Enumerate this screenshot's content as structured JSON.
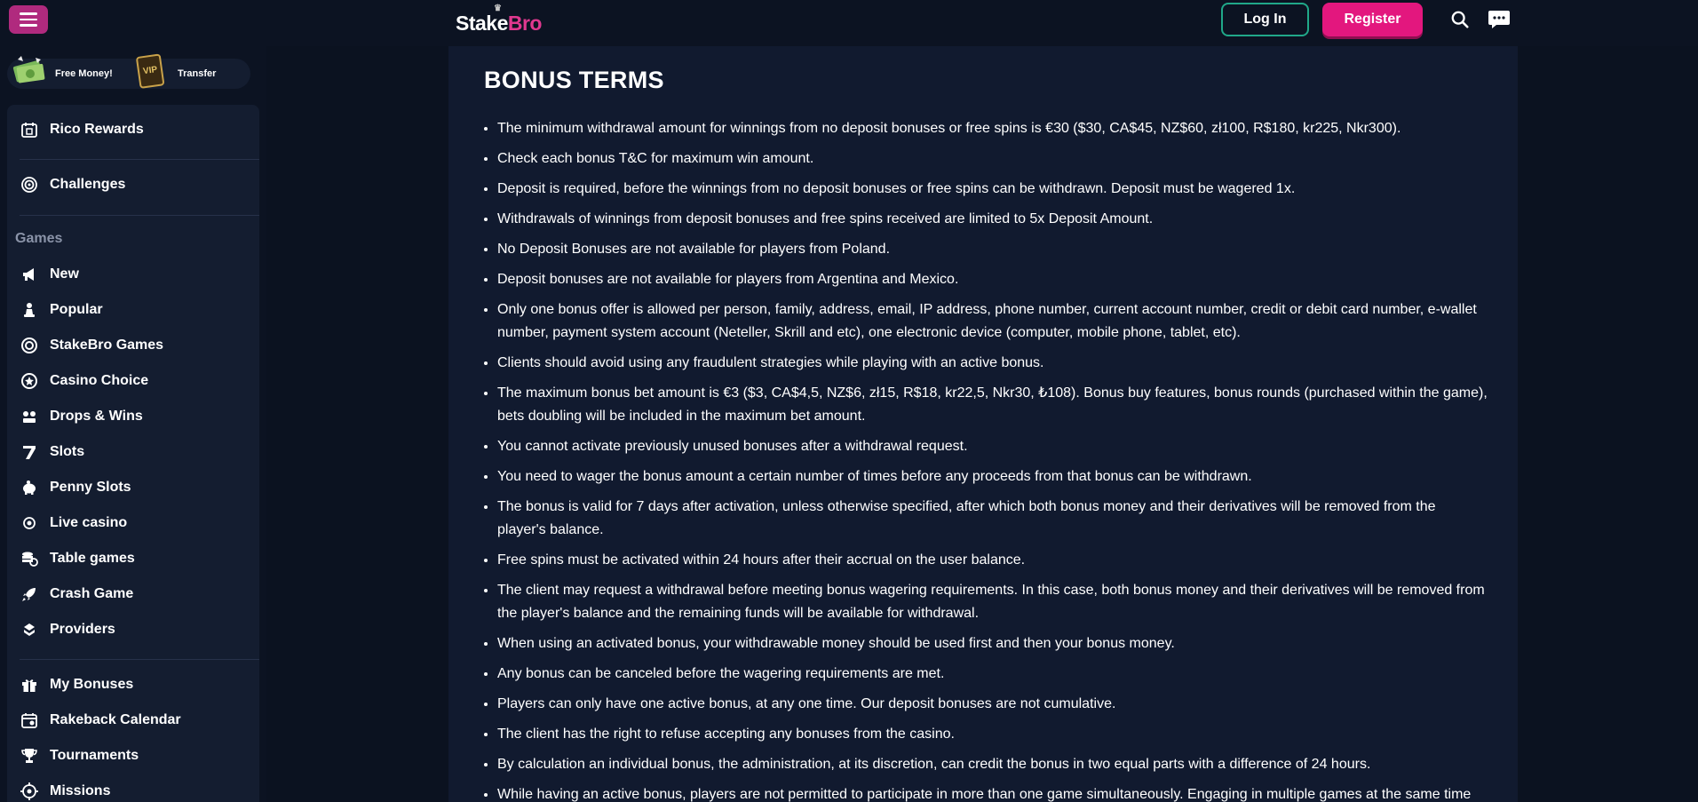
{
  "header": {
    "logo_part1": "Stake",
    "logo_part2": "Bro",
    "login_label": "Log In",
    "register_label": "Register"
  },
  "sidebar": {
    "promos": [
      {
        "label": "Free Money!"
      },
      {
        "label": "Transfer"
      }
    ],
    "top_items": [
      {
        "label": "Rico Rewards",
        "icon": "calendar-gift-icon"
      },
      {
        "label": "Challenges",
        "icon": "target-icon"
      }
    ],
    "games_label": "Games",
    "game_items": [
      {
        "label": "New",
        "icon": "megaphone-icon"
      },
      {
        "label": "Popular",
        "icon": "chess-pawn-icon"
      },
      {
        "label": "StakeBro Games",
        "icon": "chip-icon"
      },
      {
        "label": "Casino Choice",
        "icon": "star-badge-icon"
      },
      {
        "label": "Drops & Wins",
        "icon": "drops-wins-icon"
      },
      {
        "label": "Slots",
        "icon": "seven-icon"
      },
      {
        "label": "Penny Slots",
        "icon": "piggy-bank-icon"
      },
      {
        "label": "Live casino",
        "icon": "live-icon"
      },
      {
        "label": "Table games",
        "icon": "coins-stack-icon"
      },
      {
        "label": "Crash Game",
        "icon": "rocket-icon"
      },
      {
        "label": "Providers",
        "icon": "providers-icon"
      }
    ],
    "bottom_items": [
      {
        "label": "My Bonuses",
        "icon": "gift-icon"
      },
      {
        "label": "Rakeback Calendar",
        "icon": "calendar-icon"
      },
      {
        "label": "Tournaments",
        "icon": "trophy-icon"
      },
      {
        "label": "Missions",
        "icon": "crosshair-icon"
      }
    ]
  },
  "content": {
    "title": "BONUS TERMS",
    "terms": [
      "The minimum withdrawal amount for winnings from no deposit bonuses or free spins is €30 ($30, CA$45, NZ$60, zł100, R$180, kr225, Nkr300).",
      "Check each bonus T&C for maximum win amount.",
      "Deposit is required, before the winnings from no deposit bonuses or free spins can be withdrawn. Deposit must be wagered 1x.",
      "Withdrawals of winnings from deposit bonuses and free spins received are limited to 5x Deposit Amount.",
      "No Deposit Bonuses are not available for players from Poland.",
      "Deposit bonuses are not available for players from Argentina and Mexico.",
      "Only one bonus offer is allowed per person, family, address, email, IP address, phone number, current account number, credit or debit card number, e-wallet number, payment system account (Neteller, Skrill and etc), one electronic device (computer, mobile phone, tablet, etc).",
      "Clients should avoid using any fraudulent strategies while playing with an active bonus.",
      "The maximum bonus bet amount is €3 ($3, CA$4,5, NZ$6, zł15, R$18, kr22,5, Nkr30, ₺108). Bonus buy features, bonus rounds (purchased within the game), bets doubling will be included in the maximum bet amount.",
      "You cannot activate previously unused bonuses after a withdrawal request.",
      "You need to wager the bonus amount a certain number of times before any proceeds from that bonus can be withdrawn.",
      "The bonus is valid for 7 days after activation, unless otherwise specified, after which both bonus money and their derivatives will be removed from the player's balance.",
      "Free spins must be activated within 24 hours after their accrual on the user balance.",
      "The client may request a withdrawal before meeting bonus wagering requirements. In this case, both bonus money and their derivatives will be removed from the player's balance and the remaining funds will be available for withdrawal.",
      "When using an activated bonus, your withdrawable money should be used first and then your bonus money.",
      "Any bonus can be canceled before the wagering requirements are met.",
      "Players can only have one active bonus, at any one time. Our deposit bonuses are not cumulative.",
      "The client has the right to refuse accepting any bonuses from the casino.",
      "By calculation an individual bonus, the administration, at its discretion, can credit the bonus in two equal parts with a difference of 24 hours.",
      "While having an active bonus, players are not permitted to participate in more than one game simultaneously. Engaging in multiple games at the same time"
    ]
  },
  "colors": {
    "background": "#0b1220",
    "panel": "#111a2f",
    "accent_pink": "#e3177e",
    "accent_teal": "#20a889"
  }
}
